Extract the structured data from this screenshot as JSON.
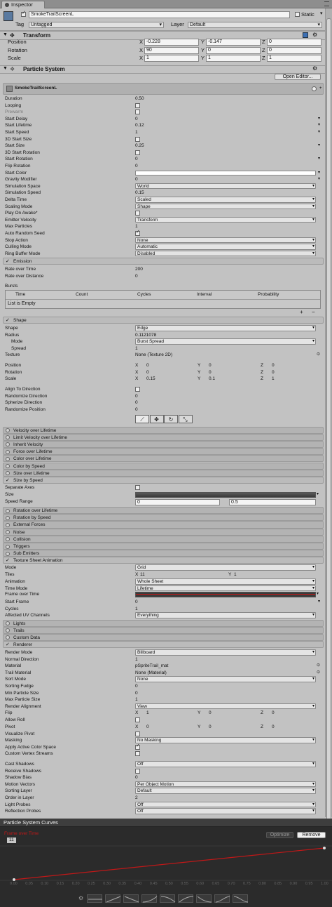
{
  "tab": {
    "title": "Inspector"
  },
  "gameobject": {
    "name": "SmokeTrailScreenL",
    "static_label": "Static",
    "tag_label": "Tag",
    "tag_value": "Untagged",
    "layer_label": "Layer",
    "layer_value": "Default"
  },
  "transform": {
    "title": "Transform",
    "rows": [
      {
        "label": "Position",
        "x": "-0.228",
        "y": "-0.147",
        "z": "0"
      },
      {
        "label": "Rotation",
        "x": "90",
        "y": "0",
        "z": "0"
      },
      {
        "label": "Scale",
        "x": "1",
        "y": "1",
        "z": "1"
      }
    ]
  },
  "particle_system": {
    "title": "Particle System",
    "open_editor": "Open Editor...",
    "subtitle": "SmokeTrailScreenL",
    "main_rows": [
      {
        "label": "Duration",
        "value": "0.50",
        "kind": "text"
      },
      {
        "label": "Looping",
        "value": "",
        "kind": "check"
      },
      {
        "label": "Prewarm",
        "value": "",
        "kind": "check",
        "gray": true
      },
      {
        "label": "Start Delay",
        "value": "0",
        "kind": "field"
      },
      {
        "label": "Start Lifetime",
        "value": "0.12",
        "kind": "field"
      },
      {
        "label": "Start Speed",
        "value": "1",
        "kind": "field"
      },
      {
        "label": "3D Start Size",
        "value": "",
        "kind": "check"
      },
      {
        "label": "Start Size",
        "value": "0.25",
        "kind": "field"
      },
      {
        "label": "3D Start Rotation",
        "value": "",
        "kind": "check"
      },
      {
        "label": "Start Rotation",
        "value": "0",
        "kind": "field"
      },
      {
        "label": "Flip Rotation",
        "value": "0",
        "kind": "text"
      },
      {
        "label": "Start Color",
        "value": "",
        "kind": "color"
      },
      {
        "label": "Gravity Modifier",
        "value": "0",
        "kind": "field"
      },
      {
        "label": "Simulation Space",
        "value": "World",
        "kind": "dd"
      },
      {
        "label": "Simulation Speed",
        "value": "0.15",
        "kind": "text"
      },
      {
        "label": "Delta Time",
        "value": "Scaled",
        "kind": "dd"
      },
      {
        "label": "Scaling Mode",
        "value": "Shape",
        "kind": "dd"
      },
      {
        "label": "Play On Awake*",
        "value": "",
        "kind": "check"
      },
      {
        "label": "Emitter Velocity",
        "value": "Transform",
        "kind": "dd"
      },
      {
        "label": "Max Particles",
        "value": "1",
        "kind": "text"
      },
      {
        "label": "Auto Random Seed",
        "value": "",
        "kind": "checkon"
      },
      {
        "label": "Stop Action",
        "value": "None",
        "kind": "dd"
      },
      {
        "label": "Culling Mode",
        "value": "Automatic",
        "kind": "dd"
      },
      {
        "label": "Ring Buffer Mode",
        "value": "Disabled",
        "kind": "dd"
      }
    ],
    "emission": {
      "title": "Emission",
      "rows": [
        {
          "label": "Rate over Time",
          "value": "200"
        },
        {
          "label": "Rate over Distance",
          "value": "0"
        }
      ],
      "bursts_label": "Bursts",
      "columns": [
        "Time",
        "Count",
        "Cycles",
        "Interval",
        "Probability"
      ],
      "empty": "List is Empty",
      "plus": "+",
      "minus": "−"
    },
    "shape": {
      "title": "Shape",
      "rows": [
        {
          "label": "Shape",
          "value": "Edge",
          "kind": "dd"
        },
        {
          "label": "Radius",
          "value": "0.1121078",
          "kind": "text"
        },
        {
          "label": "Mode",
          "value": "Burst Spread",
          "kind": "dd",
          "indent": true
        },
        {
          "label": "Spread",
          "value": "1",
          "kind": "text",
          "indent": true
        },
        {
          "label": "Texture",
          "value": "None (Texture 2D)",
          "kind": "obj"
        }
      ],
      "vectors": [
        {
          "label": "Position",
          "x": "0",
          "y": "0",
          "z": "0"
        },
        {
          "label": "Rotation",
          "x": "0",
          "y": "0",
          "z": "0"
        },
        {
          "label": "Scale",
          "x": "0.15",
          "y": "0.1",
          "z": "1"
        }
      ],
      "rows2": [
        {
          "label": "Align To Direction",
          "value": "",
          "kind": "check"
        },
        {
          "label": "Randomize Direction",
          "value": "0",
          "kind": "text"
        },
        {
          "label": "Spherize Direction",
          "value": "0",
          "kind": "text"
        },
        {
          "label": "Randomize Position",
          "value": "0",
          "kind": "text"
        }
      ]
    },
    "modules_a": [
      {
        "label": "Velocity over Lifetime",
        "on": false
      },
      {
        "label": "Limit Velocity over Lifetime",
        "on": false
      },
      {
        "label": "Inherit Velocity",
        "on": false
      },
      {
        "label": "Force over Lifetime",
        "on": false
      },
      {
        "label": "Color over Lifetime",
        "on": false
      },
      {
        "label": "Color by Speed",
        "on": false
      },
      {
        "label": "Size over Lifetime",
        "on": false
      }
    ],
    "size_by_speed": {
      "title": "Size by Speed",
      "separate_axes": "Separate Axes",
      "size": "Size",
      "speed_range": "Speed Range",
      "speed_min": "0",
      "speed_max": "0.5"
    },
    "modules_b": [
      {
        "label": "Rotation over Lifetime"
      },
      {
        "label": "Rotation by Speed"
      },
      {
        "label": "External Forces"
      },
      {
        "label": "Noise"
      },
      {
        "label": "Collision"
      },
      {
        "label": "Triggers"
      },
      {
        "label": "Sub Emitters"
      }
    ],
    "texture_sheet": {
      "title": "Texture Sheet Animation",
      "mode_label": "Mode",
      "mode": "Grid",
      "tiles_label": "Tiles",
      "tiles_x": "11",
      "tiles_y": "1",
      "animation_label": "Animation",
      "animation": "Whole Sheet",
      "time_mode_label": "Time Mode",
      "time_mode": "Lifetime",
      "frame_label": "Frame over Time",
      "start_frame_label": "Start Frame",
      "start_frame": "0",
      "cycles_label": "Cycles",
      "cycles": "1",
      "uv_label": "Affected UV Channels",
      "uv": "Everything"
    },
    "modules_c": [
      {
        "label": "Lights"
      },
      {
        "label": "Trails"
      },
      {
        "label": "Custom Data"
      }
    ],
    "renderer": {
      "title": "Renderer",
      "rows": [
        {
          "label": "Render Mode",
          "value": "Billboard",
          "kind": "dd"
        },
        {
          "label": "Normal Direction",
          "value": "1",
          "kind": "text"
        },
        {
          "label": "Material",
          "value": "pSpriteTrail_mat",
          "kind": "obj"
        },
        {
          "label": "Trail Material",
          "value": "None (Material)",
          "kind": "obj"
        },
        {
          "label": "Sort Mode",
          "value": "None",
          "kind": "dd"
        },
        {
          "label": "Sorting Fudge",
          "value": "0",
          "kind": "text"
        },
        {
          "label": "Min Particle Size",
          "value": "0",
          "kind": "text"
        },
        {
          "label": "Max Particle Size",
          "value": "1",
          "kind": "text"
        },
        {
          "label": "Render Alignment",
          "value": "View",
          "kind": "dd"
        }
      ],
      "flip": {
        "label": "Flip",
        "x": "1",
        "y": "0",
        "z": "0"
      },
      "allow_roll": "Allow Roll",
      "pivot": {
        "label": "Pivot",
        "x": "0",
        "y": "0",
        "z": "0"
      },
      "rows2": [
        {
          "label": "Visualize Pivot",
          "value": "",
          "kind": "check"
        },
        {
          "label": "Masking",
          "value": "No Masking",
          "kind": "dd"
        },
        {
          "label": "Apply Active Color Space",
          "value": "",
          "kind": "checkon"
        },
        {
          "label": "Custom Vertex Streams",
          "value": "",
          "kind": "check"
        }
      ],
      "rows3": [
        {
          "label": "Cast Shadows",
          "value": "Off",
          "kind": "dd"
        },
        {
          "label": "Receive Shadows",
          "value": "",
          "kind": "check"
        },
        {
          "label": "Shadow Bias",
          "value": "0",
          "kind": "text"
        },
        {
          "label": "Motion Vectors",
          "value": "Per Object Motion",
          "kind": "dd"
        },
        {
          "label": "Sorting Layer",
          "value": "Default",
          "kind": "dd"
        },
        {
          "label": "Order in Layer",
          "value": "2",
          "kind": "text"
        },
        {
          "label": "Light Probes",
          "value": "Off",
          "kind": "dd"
        },
        {
          "label": "Reflection Probes",
          "value": "Off",
          "kind": "dd"
        }
      ]
    }
  },
  "curves": {
    "title": "Particle System Curves",
    "optimize": "Optimize",
    "remove": "Remove",
    "curve_label": "Frame over Time",
    "top_value": "11",
    "ticks": [
      "0.00",
      "0.05",
      "0.10",
      "0.15",
      "0.20",
      "0.25",
      "0.30",
      "0.35",
      "0.40",
      "0.45",
      "0.50",
      "0.55",
      "0.60",
      "0.65",
      "0.70",
      "0.75",
      "0.80",
      "0.85",
      "0.90",
      "0.95",
      "1.00"
    ],
    "curve_color": "#c01818"
  },
  "colors": {
    "accent_red": "#c01818"
  }
}
